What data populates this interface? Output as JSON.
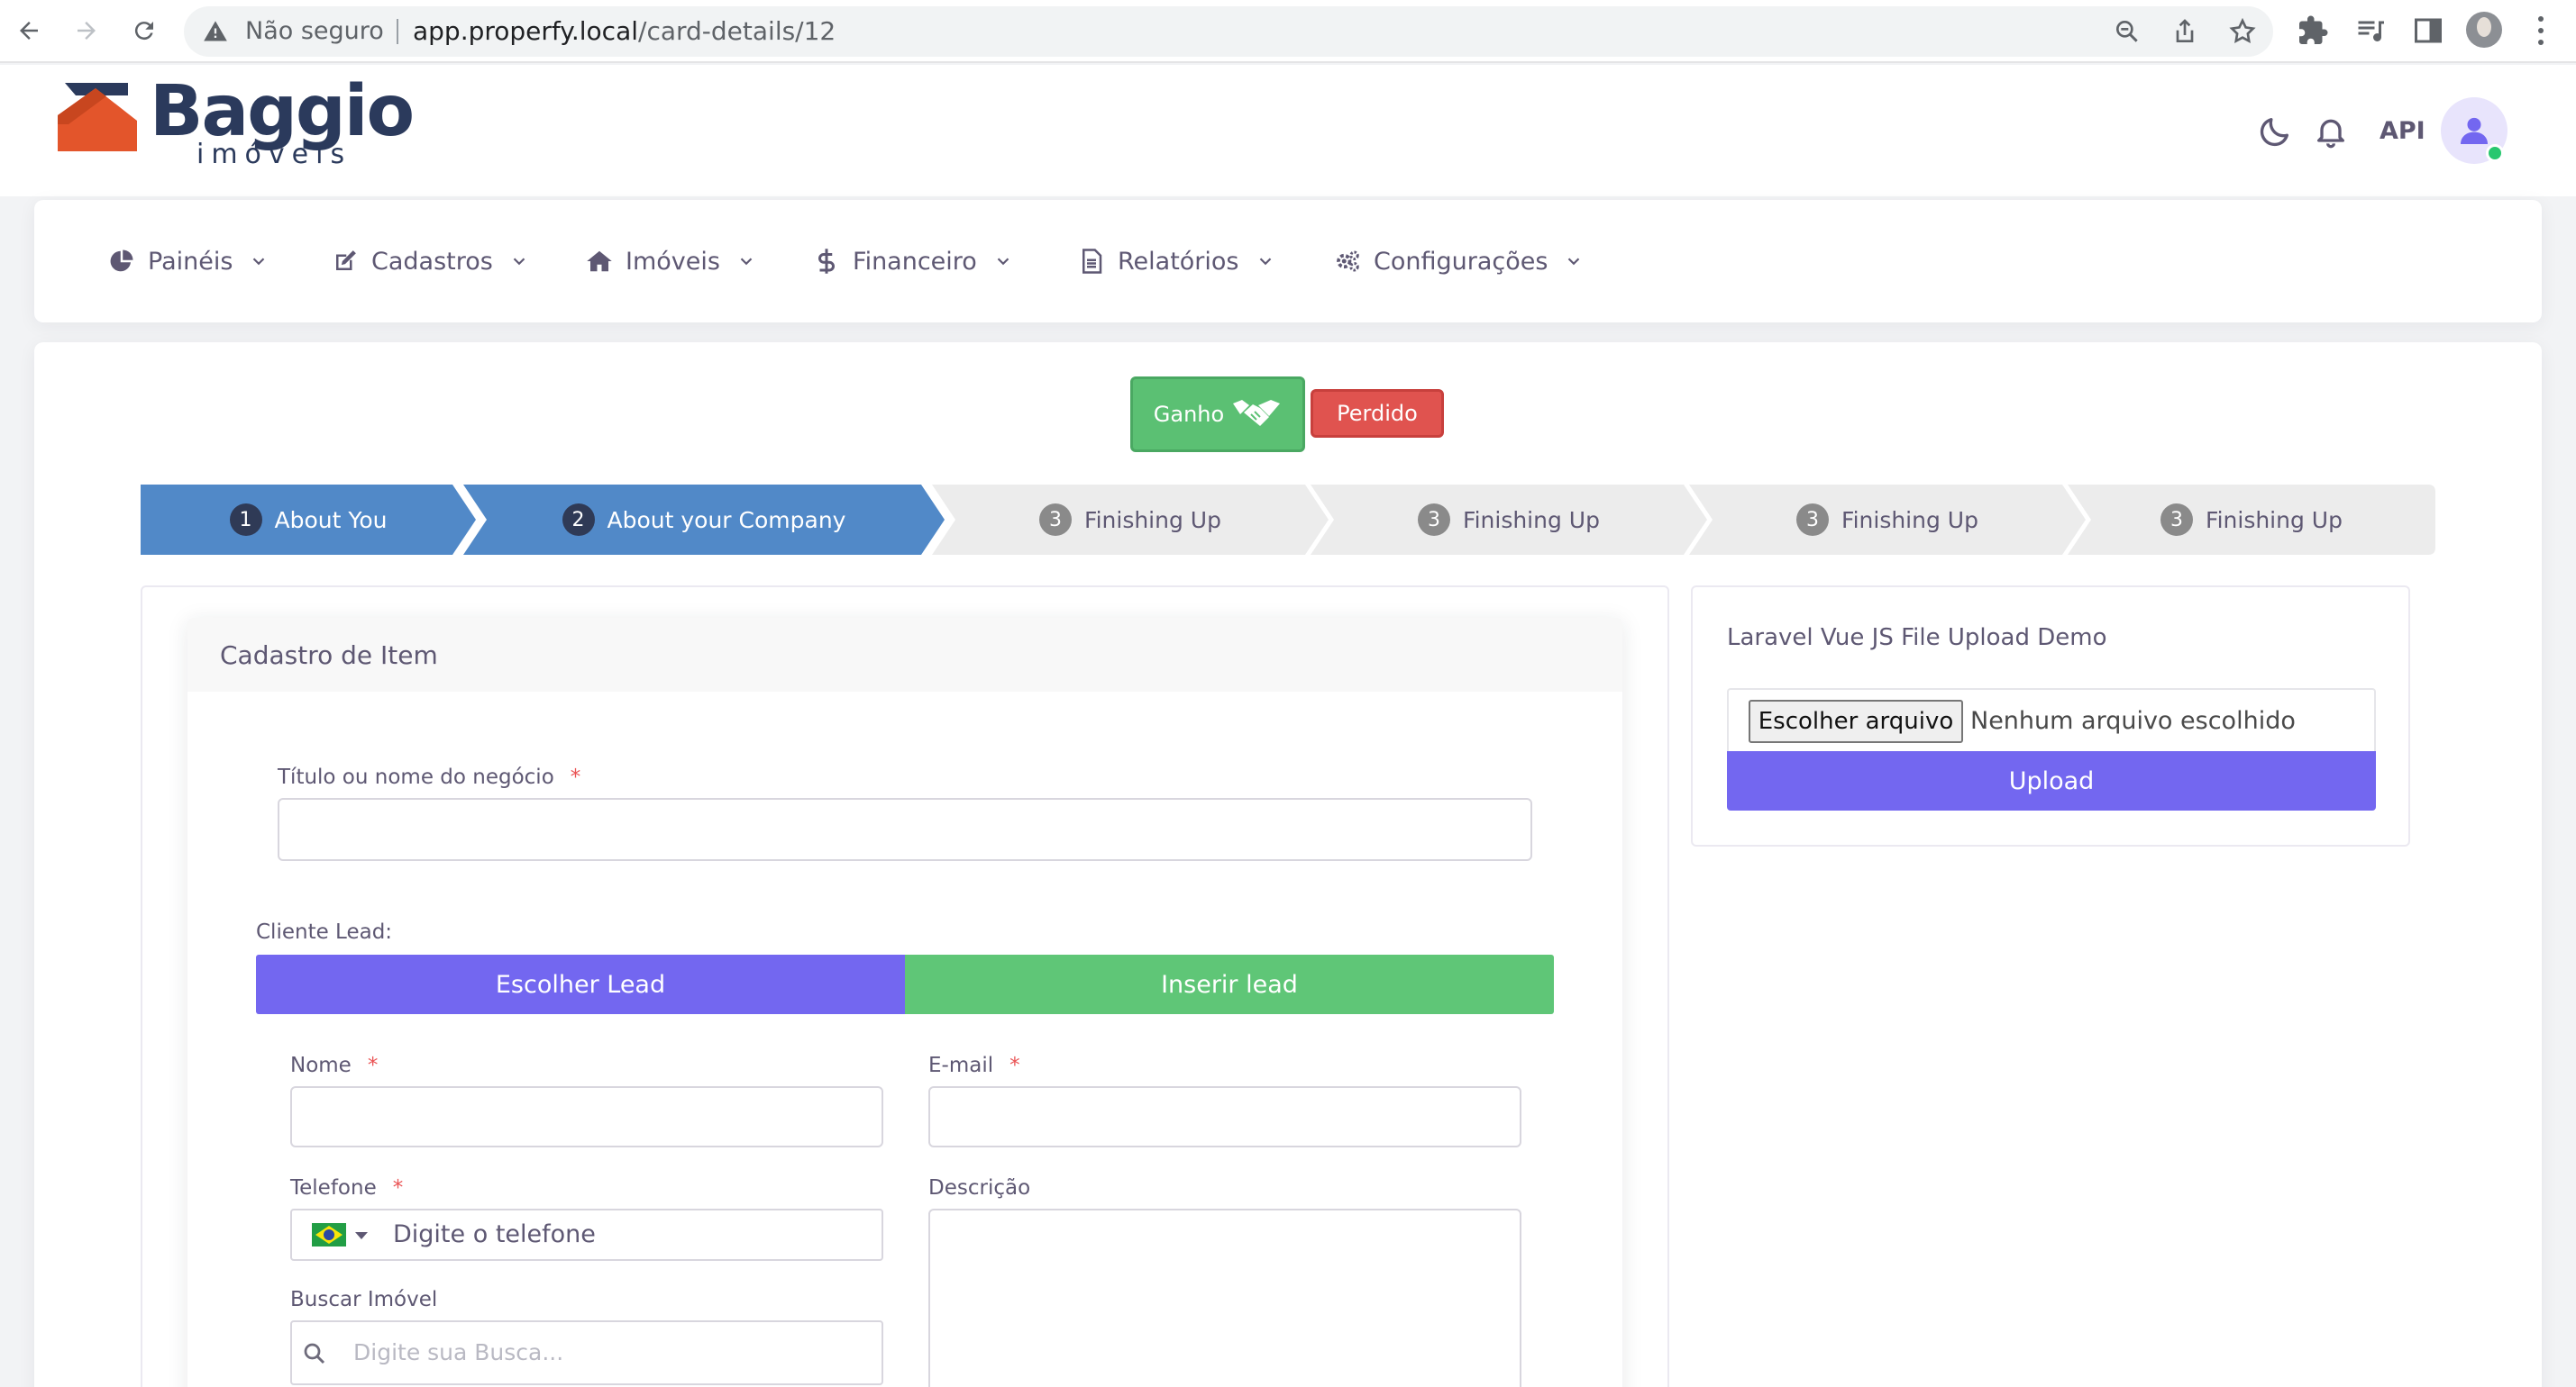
{
  "browser": {
    "security_label": "Não seguro",
    "url_host": "app.properfy.local",
    "url_path": "/card-details/12"
  },
  "brand": {
    "name": "Baggio",
    "tagline": "imóveis",
    "colors": {
      "mark_orange": "#e3552b",
      "mark_navy": "#2b3a5c"
    }
  },
  "header": {
    "api_label": "API",
    "theme_icon": "moon-icon",
    "notification_icon": "bell-icon",
    "avatar_icon": "user-icon",
    "status_color": "#28c76f"
  },
  "menu": {
    "items": [
      {
        "label": "Painéis",
        "icon": "pie-chart-icon"
      },
      {
        "label": "Cadastros",
        "icon": "edit-icon"
      },
      {
        "label": "Imóveis",
        "icon": "home-icon"
      },
      {
        "label": "Financeiro",
        "icon": "dollar-icon"
      },
      {
        "label": "Relatórios",
        "icon": "file-text-icon"
      },
      {
        "label": "Configurações",
        "icon": "cogs-icon"
      }
    ]
  },
  "actions": {
    "ganho_label": "Ganho",
    "perdido_label": "Perdido"
  },
  "steps": [
    {
      "number": "1",
      "label": "About You",
      "state": "active"
    },
    {
      "number": "2",
      "label": "About your Company",
      "state": "active"
    },
    {
      "number": "3",
      "label": "Finishing Up",
      "state": "inactive"
    },
    {
      "number": "3",
      "label": "Finishing Up",
      "state": "inactive"
    },
    {
      "number": "3",
      "label": "Finishing Up",
      "state": "inactive"
    },
    {
      "number": "3",
      "label": "Finishing Up",
      "state": "inactive"
    }
  ],
  "form": {
    "title": "Cadastro de Item",
    "deal_title_label": "Título ou nome do negócio",
    "required_mark": "*",
    "cliente_lead_label": "Cliente Lead:",
    "escolher_lead_label": "Escolher Lead",
    "inserir_lead_label": "Inserir lead",
    "nome_label": "Nome",
    "email_label": "E-mail",
    "telefone_label": "Telefone",
    "telefone_placeholder": "Digite o telefone",
    "descricao_label": "Descrição",
    "buscar_label": "Buscar Imóvel",
    "buscar_placeholder": "Digite sua Busca..."
  },
  "upload": {
    "title": "Laravel Vue JS File Upload Demo",
    "choose_file_label": "Escolher arquivo",
    "no_file_label": "Nenhum arquivo escolhido",
    "upload_label": "Upload"
  },
  "colors": {
    "primary": "#7367f0",
    "success": "#5fc677",
    "danger": "#e0534f",
    "step_active": "#5189c8",
    "step_inactive": "#ececec"
  }
}
